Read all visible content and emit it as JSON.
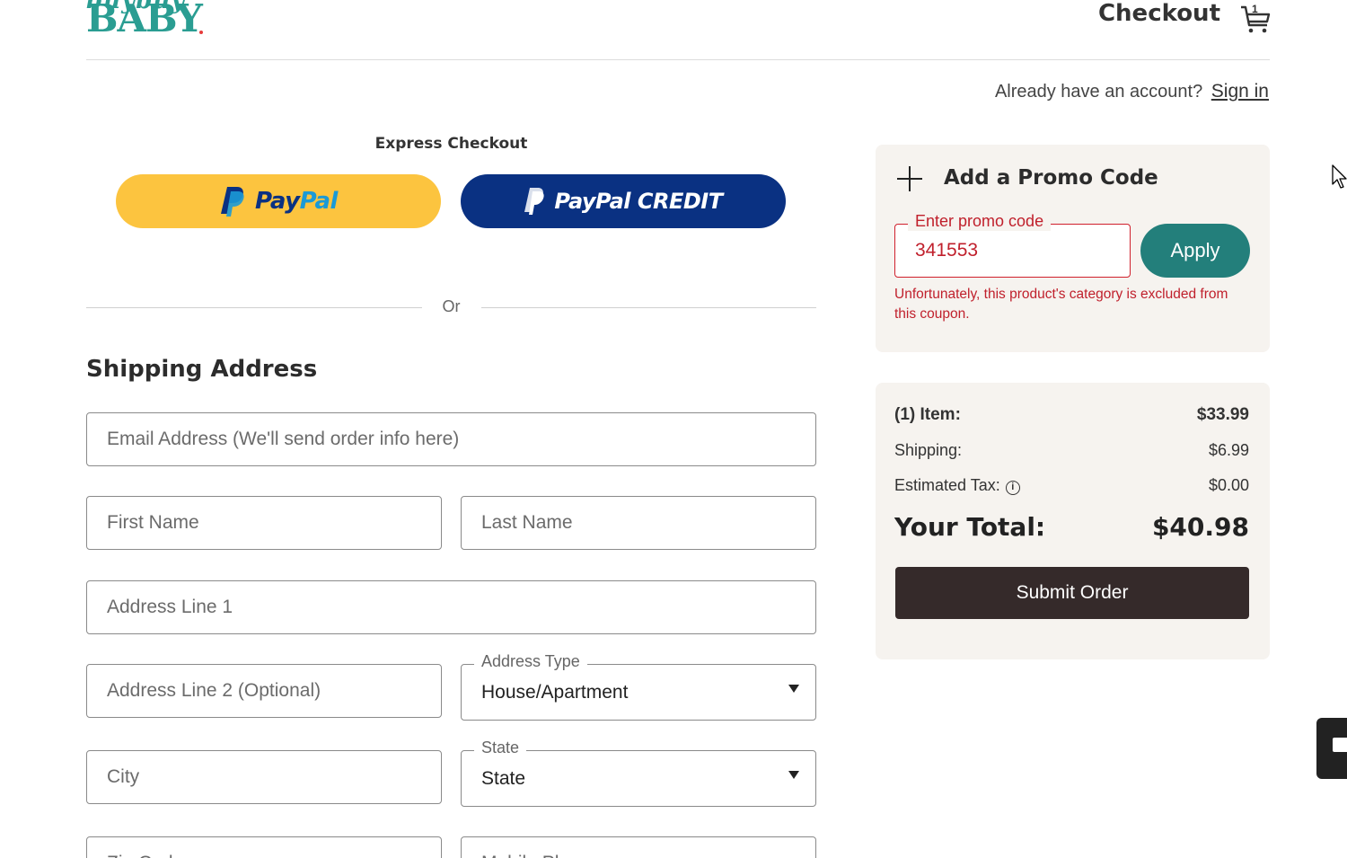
{
  "header": {
    "brand_top": "buybuy",
    "brand_main": "BABY",
    "title": "Checkout",
    "cart_count": "1"
  },
  "account": {
    "prompt": "Already have an account?",
    "signin_label": "Sign in"
  },
  "express": {
    "title": "Express Checkout",
    "paypal_label_1": "Pay",
    "paypal_label_2": "Pal",
    "paypal_credit_label": "PayPal CREDIT",
    "divider_text": "Or"
  },
  "shipping": {
    "title": "Shipping Address",
    "email_placeholder": "Email Address (We'll send order info here)",
    "first_name_placeholder": "First Name",
    "last_name_placeholder": "Last Name",
    "address1_placeholder": "Address Line 1",
    "address2_placeholder": "Address Line 2 (Optional)",
    "address_type_label": "Address Type",
    "address_type_value": "House/Apartment",
    "city_placeholder": "City",
    "state_label": "State",
    "state_value": "State",
    "zip_placeholder": "Zip Code",
    "mobile_placeholder": "Mobile Phone"
  },
  "promo": {
    "title": "Add a Promo Code",
    "field_label": "Enter promo code",
    "field_value": "341553",
    "apply_label": "Apply",
    "error": "Unfortunately, this product's category is excluded from this coupon."
  },
  "summary": {
    "items_label": "(1) Item:",
    "items_value": "$33.99",
    "shipping_label": "Shipping:",
    "shipping_value": "$6.99",
    "tax_label": "Estimated Tax:",
    "tax_value": "$0.00",
    "total_label": "Your Total:",
    "total_value": "$40.98",
    "submit_label": "Submit Order"
  },
  "colors": {
    "brand_teal": "#2a9d92",
    "apply_teal": "#237f7b",
    "error_red": "#c0202c",
    "paypal_yellow": "#fcc43f",
    "paypal_navy": "#0a3182",
    "submit_dark": "#352a2a",
    "card_bg": "#f6f3ef"
  }
}
